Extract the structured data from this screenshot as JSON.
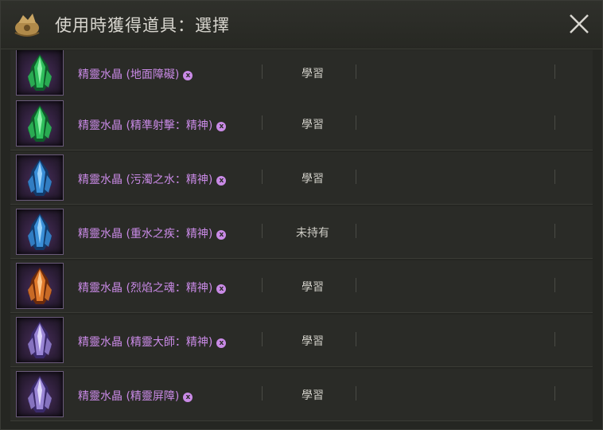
{
  "window": {
    "title": "使用時獲得道具：選擇"
  },
  "icons": {
    "title": "item-bag-icon",
    "close": "close-icon",
    "badge": "bind-mark-icon",
    "badge_glyph": "x"
  },
  "colors": {
    "item_name": "#c98ae6",
    "status": "#cfcdc6"
  },
  "items": [
    {
      "name": "精靈水晶 (地面障礙)",
      "status": "學習",
      "crystal": "green"
    },
    {
      "name": "精靈水晶 (精準射擊：精神)",
      "status": "學習",
      "crystal": "green"
    },
    {
      "name": "精靈水晶 (污濁之水：精神)",
      "status": "學習",
      "crystal": "blue"
    },
    {
      "name": "精靈水晶 (重水之疾：精神)",
      "status": "未持有",
      "crystal": "blue"
    },
    {
      "name": "精靈水晶 (烈焰之魂：精神)",
      "status": "學習",
      "crystal": "orange"
    },
    {
      "name": "精靈水晶 (精靈大師：精神)",
      "status": "學習",
      "crystal": "violet"
    },
    {
      "name": "精靈水晶 (精靈屏障)",
      "status": "學習",
      "crystal": "violet"
    }
  ]
}
